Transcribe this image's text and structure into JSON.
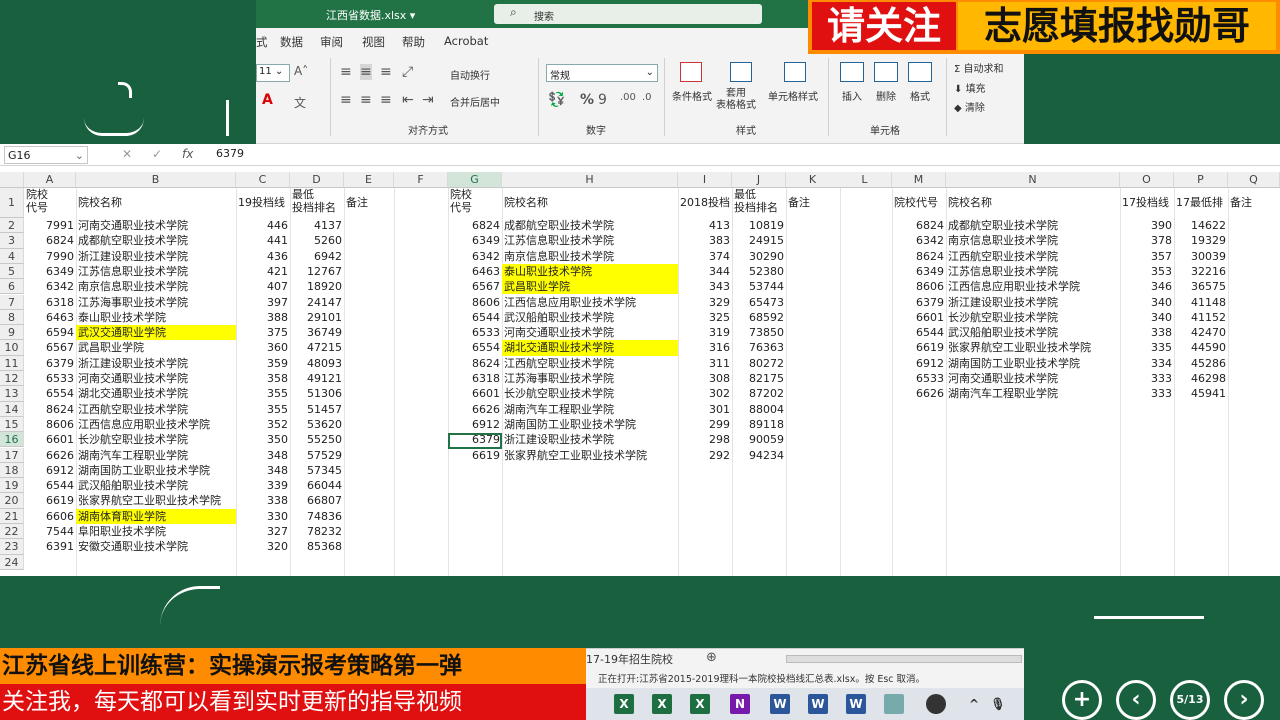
{
  "window": {
    "title": "江西省数据.xlsx  ▾",
    "search_placeholder": "搜索"
  },
  "banner_top": {
    "red": "请关注",
    "yellow": "志愿填报找勋哥"
  },
  "ribbon_tabs": [
    "式",
    "数据",
    "审阅",
    "视图",
    "帮助",
    "Acrobat"
  ],
  "ribbon": {
    "font_size": "11",
    "wrap": "自动换行",
    "merge": "合并后居中",
    "align_group": "对齐方式",
    "number_format": "常规",
    "number_group": "数字",
    "cond_format": "条件格式",
    "table_format": "套用\n表格格式",
    "cell_style": "单元格样式",
    "style_group": "样式",
    "insert": "插入",
    "delete": "删除",
    "format": "格式",
    "cells_group": "单元格",
    "autosum": "自动求和",
    "fill": "填充",
    "clear": "清除"
  },
  "formula_bar": {
    "cell_ref": "G16",
    "value": "6379"
  },
  "columns": [
    "A",
    "B",
    "C",
    "D",
    "E",
    "F",
    "G",
    "H",
    "I",
    "J",
    "K",
    "L",
    "M",
    "N",
    "O",
    "P",
    "Q"
  ],
  "row_numbers": [
    "1",
    "2",
    "3",
    "4",
    "5",
    "6",
    "7",
    "8",
    "9",
    "10",
    "11",
    "12",
    "13",
    "14",
    "15",
    "16",
    "17",
    "18",
    "19",
    "20",
    "21",
    "22",
    "23",
    "24"
  ],
  "table1": {
    "headers": [
      "院校\n代号",
      "院校名称",
      "19投档线",
      "最低\n投档排名",
      "备注"
    ],
    "rows": [
      [
        "7991",
        "河南交通职业技术学院",
        "446",
        "4137"
      ],
      [
        "6824",
        "成都航空职业技术学院",
        "441",
        "5260"
      ],
      [
        "7990",
        "浙江建设职业技术学院",
        "436",
        "6942"
      ],
      [
        "6349",
        "江苏信息职业技术学院",
        "421",
        "12767"
      ],
      [
        "6342",
        "南京信息职业技术学院",
        "407",
        "18920"
      ],
      [
        "6318",
        "江苏海事职业技术学院",
        "397",
        "24147"
      ],
      [
        "6463",
        "泰山职业技术学院",
        "388",
        "29101"
      ],
      [
        "6594",
        "武汉交通职业学院",
        "375",
        "36749"
      ],
      [
        "6567",
        "武昌职业学院",
        "360",
        "47215"
      ],
      [
        "6379",
        "浙江建设职业技术学院",
        "359",
        "48093"
      ],
      [
        "6533",
        "河南交通职业技术学院",
        "358",
        "49121"
      ],
      [
        "6554",
        "湖北交通职业技术学院",
        "355",
        "51306"
      ],
      [
        "8624",
        "江西航空职业技术学院",
        "355",
        "51457"
      ],
      [
        "8606",
        "江西信息应用职业技术学院",
        "352",
        "53620"
      ],
      [
        "6601",
        "长沙航空职业技术学院",
        "350",
        "55250"
      ],
      [
        "6626",
        "湖南汽车工程职业学院",
        "348",
        "57529"
      ],
      [
        "6912",
        "湖南国防工业职业技术学院",
        "348",
        "57345"
      ],
      [
        "6544",
        "武汉船舶职业技术学院",
        "339",
        "66044"
      ],
      [
        "6619",
        "张家界航空工业职业技术学院",
        "338",
        "66807"
      ],
      [
        "6606",
        "湖南体育职业学院",
        "330",
        "74836"
      ],
      [
        "7544",
        "阜阳职业技术学院",
        "327",
        "78232"
      ],
      [
        "6391",
        "安徽交通职业技术学院",
        "320",
        "85368"
      ]
    ],
    "highlight_rows": [
      7,
      19
    ]
  },
  "table2": {
    "headers": [
      "院校\n代号",
      "院校名称",
      "2018投档",
      "最低\n投档排名",
      "备注"
    ],
    "rows": [
      [
        "6824",
        "成都航空职业技术学院",
        "413",
        "10819"
      ],
      [
        "6349",
        "江苏信息职业技术学院",
        "383",
        "24915"
      ],
      [
        "6342",
        "南京信息职业技术学院",
        "374",
        "30290"
      ],
      [
        "6463",
        "泰山职业技术学院",
        "344",
        "52380"
      ],
      [
        "6567",
        "武昌职业学院",
        "343",
        "53744"
      ],
      [
        "8606",
        "江西信息应用职业技术学院",
        "329",
        "65473"
      ],
      [
        "6544",
        "武汉船舶职业技术学院",
        "325",
        "68592"
      ],
      [
        "6533",
        "河南交通职业技术学院",
        "319",
        "73850"
      ],
      [
        "6554",
        "湖北交通职业技术学院",
        "316",
        "76363"
      ],
      [
        "8624",
        "江西航空职业技术学院",
        "311",
        "80272"
      ],
      [
        "6318",
        "江苏海事职业技术学院",
        "308",
        "82175"
      ],
      [
        "6601",
        "长沙航空职业技术学院",
        "302",
        "87202"
      ],
      [
        "6626",
        "湖南汽车工程职业学院",
        "301",
        "88004"
      ],
      [
        "6912",
        "湖南国防工业职业技术学院",
        "299",
        "89118"
      ],
      [
        "6379",
        "浙江建设职业技术学院",
        "298",
        "90059"
      ],
      [
        "6619",
        "张家界航空工业职业技术学院",
        "292",
        "94234"
      ]
    ],
    "highlight_rows": [
      3,
      4,
      8
    ]
  },
  "table3": {
    "headers": [
      "院校代号",
      "院校名称",
      "17投档线",
      "17最低排",
      "备注"
    ],
    "rows": [
      [
        "6824",
        "成都航空职业技术学院",
        "390",
        "14622"
      ],
      [
        "6342",
        "南京信息职业技术学院",
        "378",
        "19329"
      ],
      [
        "8624",
        "江西航空职业技术学院",
        "357",
        "30039"
      ],
      [
        "6349",
        "江苏信息职业技术学院",
        "353",
        "32216"
      ],
      [
        "8606",
        "江西信息应用职业技术学院",
        "346",
        "36575"
      ],
      [
        "6379",
        "浙江建设职业技术学院",
        "340",
        "41148"
      ],
      [
        "6601",
        "长沙航空职业技术学院",
        "340",
        "41152"
      ],
      [
        "6544",
        "武汉船舶职业技术学院",
        "338",
        "42470"
      ],
      [
        "6619",
        "张家界航空工业职业技术学院",
        "335",
        "44590"
      ],
      [
        "6912",
        "湖南国防工业职业技术学院",
        "334",
        "45286"
      ],
      [
        "6533",
        "河南交通职业技术学院",
        "333",
        "46298"
      ],
      [
        "6626",
        "湖南汽车工程职业学院",
        "333",
        "45941"
      ]
    ]
  },
  "sheet_tab": "17-19年招生院校",
  "status_text": "正在打开:江苏省2015-2019理科一本院校投档线汇总表.xlsx。按 Esc 取消。",
  "lower_banner": {
    "line1": "江苏省线上训练营：实操演示报考策略第一弹",
    "line2": "关注我，每天都可以看到实时更新的指导视频"
  },
  "nav": {
    "page": "5/13"
  },
  "colors": {
    "excel_green": "#217346",
    "highlight": "#ffff00",
    "board": "#19603f",
    "orange": "#ff8c00",
    "red": "#e01010"
  }
}
